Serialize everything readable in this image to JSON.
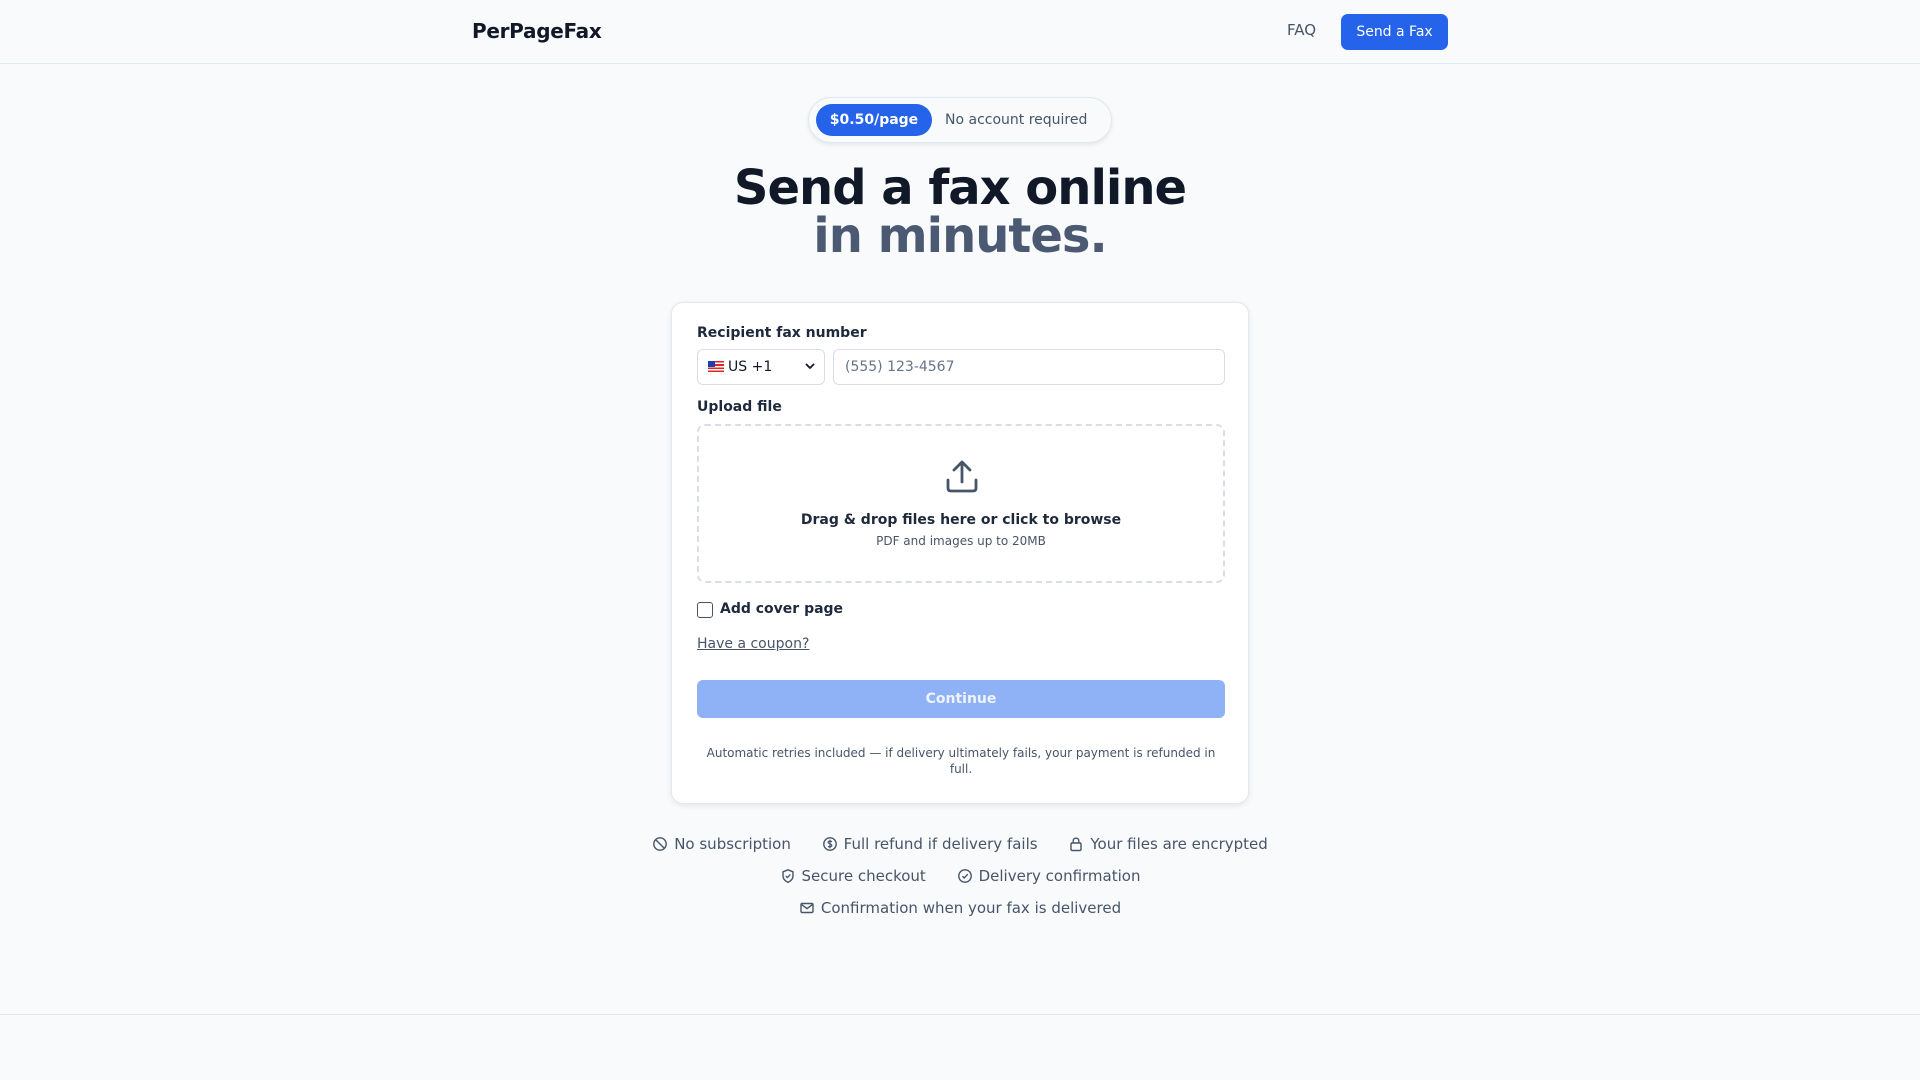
{
  "header": {
    "brand": "PerPageFax",
    "nav_faq": "FAQ",
    "nav_send": "Send a Fax"
  },
  "badge": {
    "price": "$0.50/page",
    "text": "No account required"
  },
  "hero": {
    "line1": "Send a fax online",
    "line2": "in minutes."
  },
  "form": {
    "recipient_label": "Recipient fax number",
    "country_value": "US +1",
    "country_flag": "us-flag-icon",
    "fax_placeholder": "(555) 123-4567",
    "upload_label": "Upload file",
    "drop_title": "Drag & drop files here or click to browse",
    "drop_subtitle": "PDF and images up to 20MB",
    "cover_page_label": "Add cover page",
    "coupon_link": "Have a coupon?",
    "continue_label": "Continue",
    "note": "Automatic retries included — if delivery ultimately fails, your payment is refunded in full."
  },
  "features": {
    "row1": [
      {
        "icon": "ban-icon",
        "label": "No subscription"
      },
      {
        "icon": "dollar-circle-icon",
        "label": "Full refund if delivery fails"
      },
      {
        "icon": "lock-icon",
        "label": "Your files are encrypted"
      }
    ],
    "row2": [
      {
        "icon": "shield-icon",
        "label": "Secure checkout"
      },
      {
        "icon": "check-circle-icon",
        "label": "Delivery confirmation"
      }
    ],
    "row3": [
      {
        "icon": "mail-icon",
        "label": "Confirmation when your fax is delivered"
      }
    ]
  },
  "colors": {
    "accent": "#2563eb",
    "accent_disabled": "#8fb2f7",
    "heading": "#111827",
    "heading_secondary": "#4b5a72",
    "muted_text": "#475569",
    "background": "#f8fafc"
  }
}
